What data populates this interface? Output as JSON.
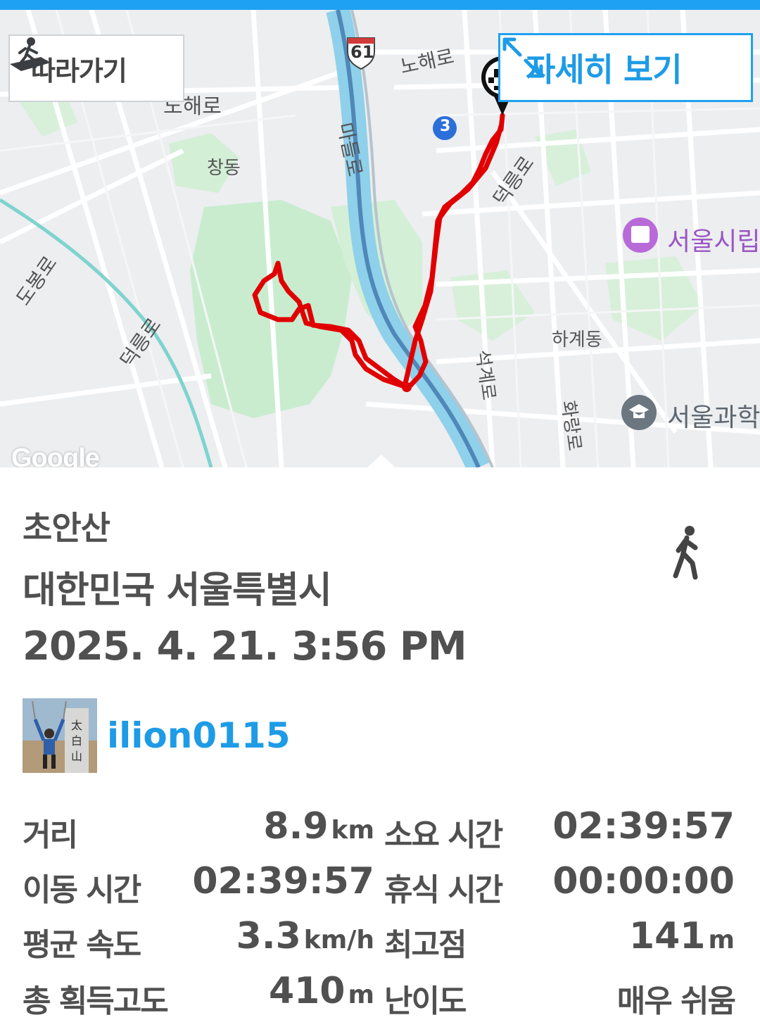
{
  "map": {
    "follow_button_label": "따라가기",
    "detail_button_label": "자세히 보기",
    "provider_logo": "Google",
    "labels": {
      "route_61": "61",
      "nohae_ro_1": "노해로",
      "nohae_ro_2": "노해로",
      "changdong": "창동",
      "madeul_ro": "마들로",
      "line_3": "3",
      "deokreung_ro_1": "덕릉로",
      "deokreung_ro_2": "덕릉로",
      "dobong_ro": "도봉로",
      "seoul_city_poi": "서울시립",
      "hagye_dong": "하계동",
      "hwarang_ro": "화랑로",
      "seokgye_ro": "석계로",
      "seoul_science_poi": "서울과학"
    },
    "route_color": "#e00000",
    "accent_color": "#1ea1f2"
  },
  "activity": {
    "title": "초안산",
    "location": "대한민국 서울특별시",
    "datetime": "2025. 4. 21. 3:56 PM",
    "activity_type_icon": "walking-icon",
    "username": "ilion0115",
    "avatar_sign_text": "太白山"
  },
  "stats": {
    "distance_label": "거리",
    "distance_value": "8.9",
    "distance_unit": "km",
    "total_time_label": "소요 시간",
    "total_time_value": "02:39:57",
    "moving_time_label": "이동 시간",
    "moving_time_value": "02:39:57",
    "rest_time_label": "휴식 시간",
    "rest_time_value": "00:00:00",
    "avg_speed_label": "평균 속도",
    "avg_speed_value": "3.3",
    "avg_speed_unit": "km/h",
    "max_altitude_label": "최고점",
    "max_altitude_value": "141",
    "max_altitude_unit": "m",
    "total_ascent_label": "총 획득고도",
    "total_ascent_value": "410",
    "total_ascent_unit": "m",
    "difficulty_label": "난이도",
    "difficulty_value": "매우 쉬움"
  }
}
